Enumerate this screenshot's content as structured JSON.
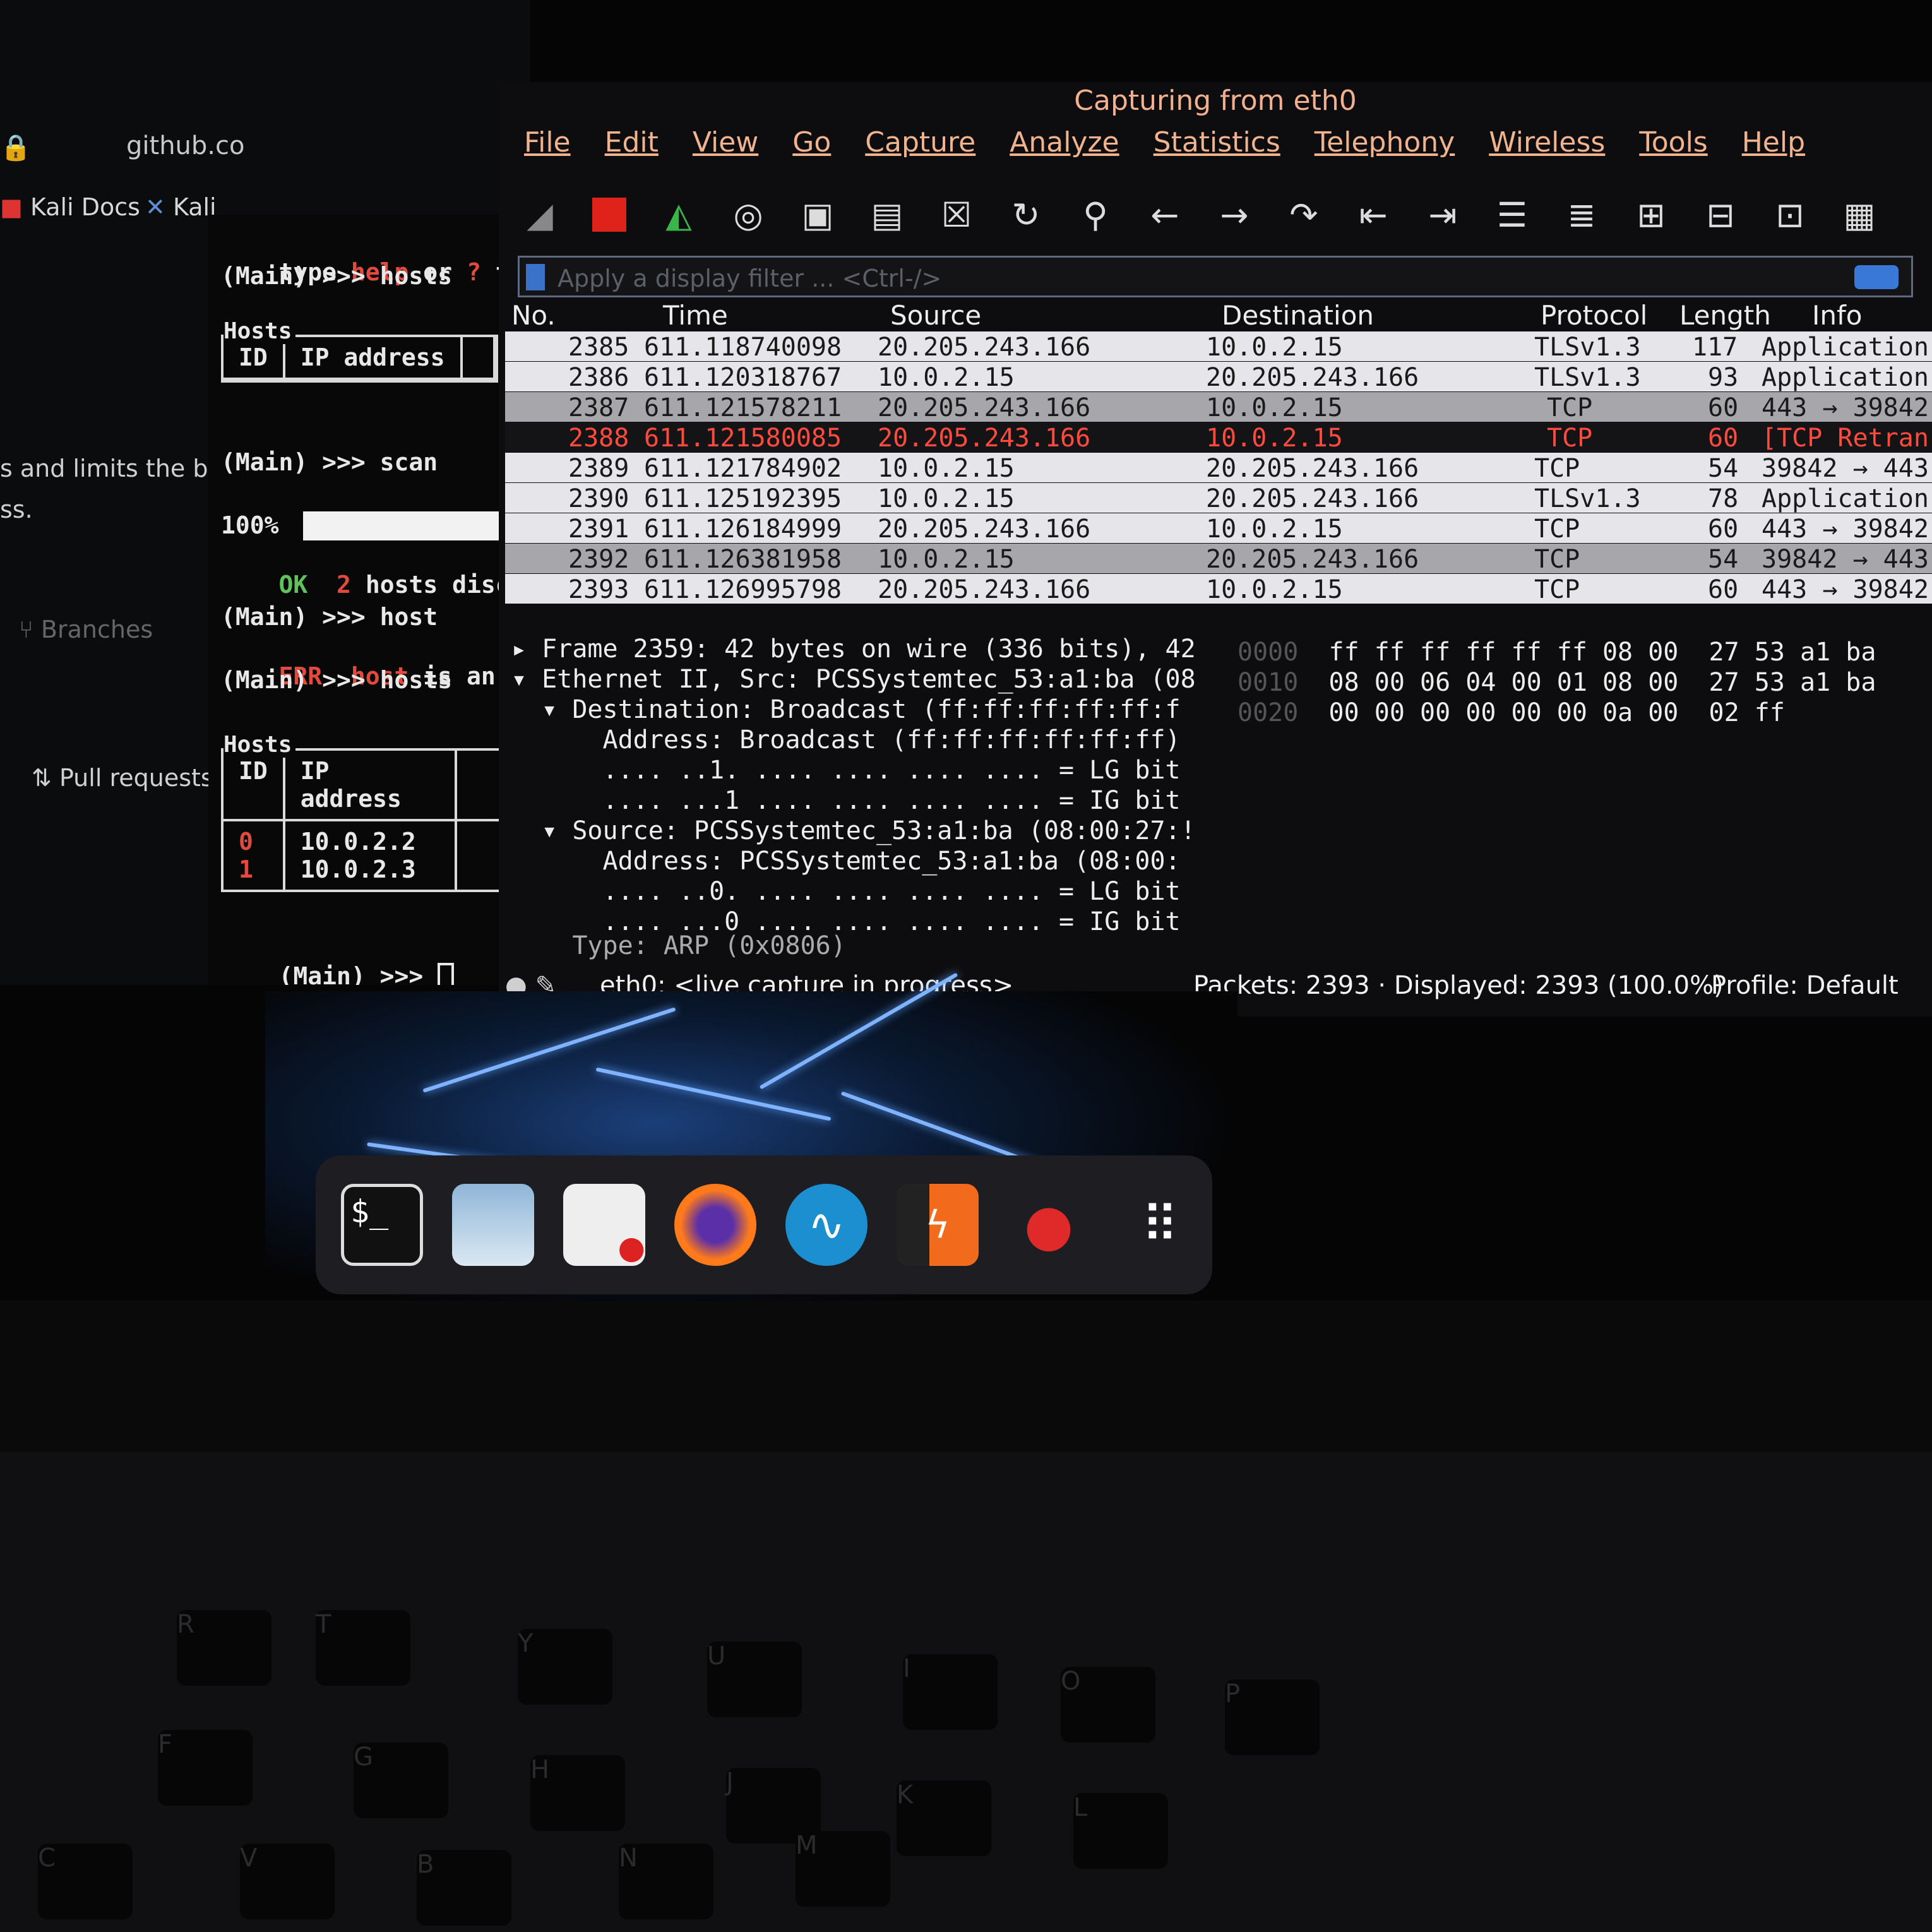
{
  "browser": {
    "url": "github.co",
    "bookmarks": [
      "Kali Docs",
      "Kali"
    ],
    "side_text_1": "s and limits the ba",
    "side_text_2": "ss.",
    "branches": "Branches",
    "pull_requests": "Pull requests"
  },
  "terminal": {
    "help_line_a": "type ",
    "help_word": "help",
    "help_line_b": " or ",
    "help_q": "?",
    "help_line_c": " to sh",
    "cmd1": "(Main) >>> hosts",
    "hosts_caption": "Hosts",
    "col_id": "ID",
    "col_ip": "IP address",
    "cmd2": "(Main) >>> scan",
    "progress_pct": "100%",
    "progress_value": 1.0,
    "ok_label": "OK",
    "ok_count": "2",
    "ok_text": " hosts discove",
    "cmd3": "(Main) >>> host",
    "err_label": "ERR",
    "err_word": "host",
    "err_text": " is an unkn",
    "cmd4": "(Main) >>> hosts",
    "hosts_rows": [
      {
        "id": "0",
        "ip": "10.0.2.2"
      },
      {
        "id": "1",
        "ip": "10.0.2.3"
      }
    ],
    "prompt": "(Main) >>> "
  },
  "wireshark": {
    "title": "Capturing from eth0",
    "menu": [
      "File",
      "Edit",
      "View",
      "Go",
      "Capture",
      "Analyze",
      "Statistics",
      "Telephony",
      "Wireless",
      "Tools",
      "Help"
    ],
    "filter_placeholder": "Apply a display filter ... <Ctrl-/>",
    "columns": [
      "No.",
      "Time",
      "Source",
      "Destination",
      "Protocol",
      "Length",
      "Info"
    ],
    "packets": [
      {
        "no": "2385",
        "time": "611.118740098",
        "src": "20.205.243.166",
        "dst": "10.0.2.15",
        "proto": "TLSv1.3",
        "len": "117",
        "info": "Application"
      },
      {
        "no": "2386",
        "time": "611.120318767",
        "src": "10.0.2.15",
        "dst": "20.205.243.166",
        "proto": "TLSv1.3",
        "len": "93",
        "info": "Application"
      },
      {
        "no": "2387",
        "time": "611.121578211",
        "src": "20.205.243.166",
        "dst": "10.0.2.15",
        "proto": "TCP",
        "len": "60",
        "info": "443 → 39842"
      },
      {
        "no": "2388",
        "time": "611.121580085",
        "src": "20.205.243.166",
        "dst": "10.0.2.15",
        "proto": "TCP",
        "len": "60",
        "info": "[TCP Retran"
      },
      {
        "no": "2389",
        "time": "611.121784902",
        "src": "10.0.2.15",
        "dst": "20.205.243.166",
        "proto": "TCP",
        "len": "54",
        "info": "39842 → 443"
      },
      {
        "no": "2390",
        "time": "611.125192395",
        "src": "10.0.2.15",
        "dst": "20.205.243.166",
        "proto": "TLSv1.3",
        "len": "78",
        "info": "Application"
      },
      {
        "no": "2391",
        "time": "611.126184999",
        "src": "20.205.243.166",
        "dst": "10.0.2.15",
        "proto": "TCP",
        "len": "60",
        "info": "443 → 39842"
      },
      {
        "no": "2392",
        "time": "611.126381958",
        "src": "10.0.2.15",
        "dst": "20.205.243.166",
        "proto": "TCP",
        "len": "54",
        "info": "39842 → 443"
      },
      {
        "no": "2393",
        "time": "611.126995798",
        "src": "20.205.243.166",
        "dst": "10.0.2.15",
        "proto": "TCP",
        "len": "60",
        "info": "443 → 39842"
      }
    ],
    "details": [
      "▸ Frame 2359: 42 bytes on wire (336 bits), 42",
      "▾ Ethernet II, Src: PCSSystemtec_53:a1:ba (08",
      "  ▾ Destination: Broadcast (ff:ff:ff:ff:ff:f",
      "      Address: Broadcast (ff:ff:ff:ff:ff:ff)",
      "      .... ..1. .... .... .... .... = LG bit",
      "      .... ...1 .... .... .... .... = IG bit",
      "  ▾ Source: PCSSystemtec_53:a1:ba (08:00:27:!",
      "      Address: PCSSystemtec_53:a1:ba (08:00:",
      "      .... ..0. .... .... .... .... = LG bit",
      "      .... ...0 .... .... .... .... = IG bit",
      "    Type: ARP (0x0806)"
    ],
    "hex": [
      {
        "off": "0000",
        "bytes": "ff ff ff ff ff ff 08 00  27 53 a1 ba"
      },
      {
        "off": "0010",
        "bytes": "08 00 06 04 00 01 08 00  27 53 a1 ba"
      },
      {
        "off": "0020",
        "bytes": "00 00 00 00 00 00 0a 00  02 ff"
      }
    ],
    "status_capture": "eth0: <live capture in progress>",
    "status_packets": "Packets: 2393 · Displayed: 2393 (100.0%)",
    "status_profile": "Profile: Default"
  },
  "dock": {
    "terminal_glyph": "$_"
  },
  "keyboard": {
    "labels": [
      "R",
      "T",
      "Y",
      "U",
      "I",
      "O",
      "P",
      "F",
      "G",
      "H",
      "J",
      "K",
      "L",
      "C",
      "V",
      "B",
      "N",
      "M"
    ]
  },
  "colors": {
    "ws_accent": "#f1b38e",
    "selected_row_text": "#ff4a3e",
    "terminal_err": "#e24a3d",
    "terminal_ok": "#5fc25a"
  }
}
